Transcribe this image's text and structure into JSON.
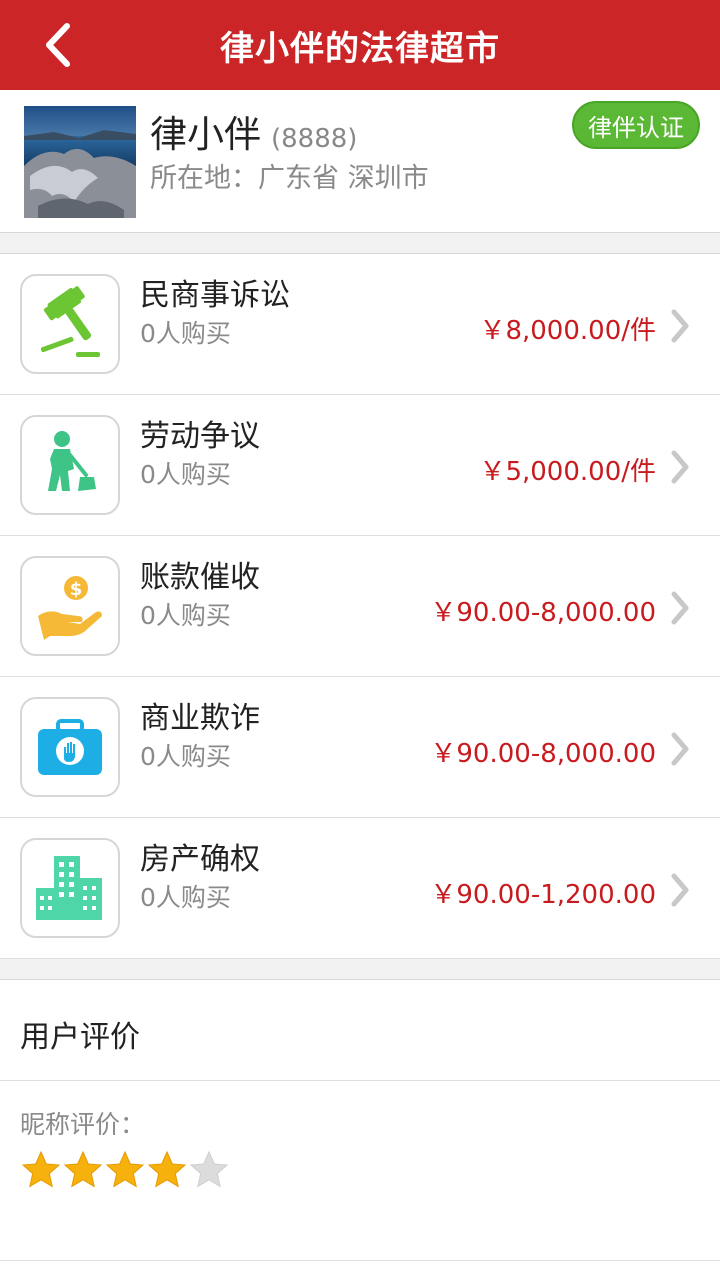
{
  "header": {
    "title": "律小伴的法律超市",
    "back_icon": "chevron-left-icon"
  },
  "profile": {
    "name": "律小伴",
    "id": "(8888)",
    "location": "所在地：广东省 深圳市",
    "badge": "律伴认证",
    "badge_color": "#5ab834"
  },
  "services": [
    {
      "name": "民商事诉讼",
      "buyers": "0人购买",
      "price": "￥8,000.00/件",
      "icon": "gavel-icon",
      "icon_color": "#6cc633"
    },
    {
      "name": "劳动争议",
      "buyers": "0人购买",
      "price": "￥5,000.00/件",
      "icon": "worker-icon",
      "icon_color": "#3ec487"
    },
    {
      "name": "账款催收",
      "buyers": "0人购买",
      "price": "￥90.00-8,000.00",
      "icon": "money-hand-icon",
      "icon_color": "#f5b937"
    },
    {
      "name": "商业欺诈",
      "buyers": "0人购买",
      "price": "￥90.00-8,000.00",
      "icon": "briefcase-hand-icon",
      "icon_color": "#1eaee6"
    },
    {
      "name": "房产确权",
      "buyers": "0人购买",
      "price": "￥90.00-1,200.00",
      "icon": "buildings-icon",
      "icon_color": "#4fd6a8"
    }
  ],
  "reviews": {
    "title": "用户评价",
    "label": "昵称评价：",
    "rating": 4,
    "max_rating": 5
  },
  "colors": {
    "brand_red": "#cc2527",
    "price_red": "#c81b1f",
    "star_gold": "#f6b10c"
  }
}
